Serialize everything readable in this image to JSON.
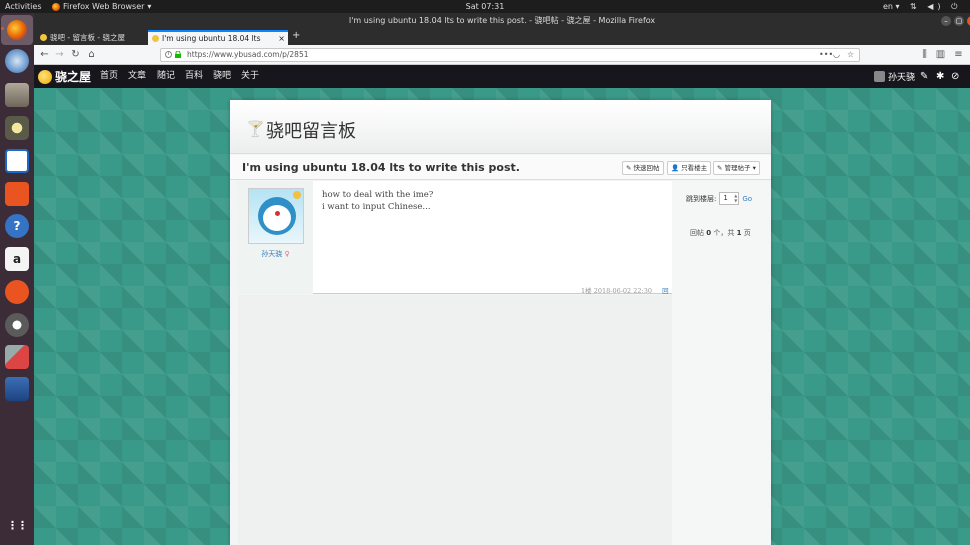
{
  "system": {
    "activities": "Activities",
    "app_name": "Firefox Web Browser",
    "app_arrow": "▾",
    "clock": "Sat 07:31",
    "lang": "en ▾",
    "tray": "⇅ ◀) ⏻ ▾"
  },
  "dock": {
    "items": [
      "firefox-icon",
      "thunderbird-icon",
      "files-icon",
      "rhythmbox-icon",
      "writer-icon",
      "software-center-icon",
      "help-icon",
      "amazon-icon",
      "ubuntu-icon",
      "updater-icon",
      "settings-icon",
      "drive-icon",
      "app-grid-icon"
    ],
    "amazon_glyph": "a",
    "help_glyph": "?",
    "grid_glyph": "⋮⋮"
  },
  "browser": {
    "window_title": "I'm using ubuntu 18.04 lts to write this post. - 骁吧帖 - 骁之屋 - Mozilla Firefox",
    "tabs": [
      {
        "label": "骁吧 - 留言板 - 骁之屋",
        "active": false
      },
      {
        "label": "I'm using ubuntu 18.04 lts",
        "active": true
      }
    ],
    "tab_close": "×",
    "new_tab": "+",
    "url": "https://www.ybusad.com/p/2851",
    "url_more": "•••",
    "win_min": "–",
    "win_max": "▢",
    "win_close": "×",
    "back": "←",
    "forward": "→",
    "reload": "↻",
    "home": "⌂",
    "library": "⫼",
    "sidebar": "▥",
    "menu": "≡",
    "pocket": "◡",
    "star": "☆"
  },
  "site": {
    "logo_text": "骁之屋",
    "nav": [
      "首页",
      "文章",
      "随记",
      "百科",
      "骁吧",
      "关于"
    ],
    "username": "孙天骁",
    "icons": [
      "edit-icon",
      "tools-icon",
      "logout-icon"
    ]
  },
  "board": {
    "title": "骁吧留言板",
    "post_title": "I'm using ubuntu 18.04 lts to write this post.",
    "buttons": {
      "quick_reply": "✎ 快速回帖",
      "author_only": "👤 只看楼主",
      "manage": "✎ 管理帖子 ▾"
    },
    "post": {
      "author": "孙天骁",
      "gender_mark": "♀",
      "lines": [
        "how to deal with the ime?",
        "i want to input Chinese..."
      ],
      "floor_meta": "1楼  2018-06-02 22:30",
      "reply_link": "回帖"
    },
    "sidebar": {
      "jump_label": "跳到楼层:",
      "jump_value": "1",
      "go": "Go",
      "count_prefix": "回帖",
      "count_value": "0",
      "count_mid": "个，共",
      "pages_value": "1",
      "count_suffix": "页"
    }
  },
  "colors": {
    "accent": "#0a84ff",
    "ubuntu_orange": "#e95420",
    "teal_bg": "#3a9a89",
    "link": "#3a7cbd"
  }
}
